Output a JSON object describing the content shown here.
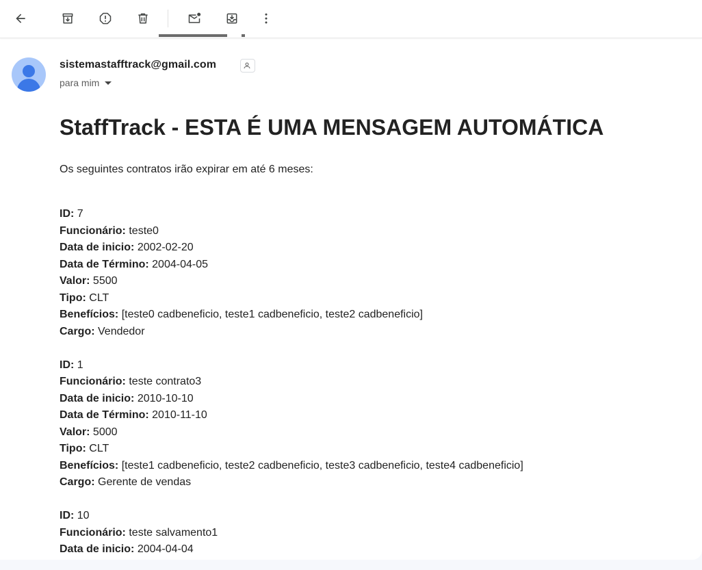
{
  "toolbar": {
    "back": "arrow-left-icon",
    "archive": "archive-icon",
    "spam": "report-spam-icon",
    "delete": "trash-icon",
    "unread": "mark-unread-icon",
    "move": "move-to-inbox-icon",
    "more": "more-vert-icon"
  },
  "email": {
    "sender": "sistemastafftrack@gmail.com",
    "recipient": "para mim",
    "title": "StaffTrack - ESTA É UMA MENSAGEM AUTOMÁTICA",
    "intro": "Os seguintes contratos irão expirar em até 6 meses:"
  },
  "contracts": [
    {
      "rows": [
        {
          "label": "ID:",
          "value": "7"
        },
        {
          "label": "Funcionário:",
          "value": "teste0"
        },
        {
          "label": "Data de inicio:",
          "value": "2002-02-20"
        },
        {
          "label": "Data de Término:",
          "value": "2004-04-05"
        },
        {
          "label": "Valor:",
          "value": "5500"
        },
        {
          "label": "Tipo:",
          "value": "CLT"
        },
        {
          "label": "Benefícios:",
          "value": "[teste0 cadbeneficio, teste1 cadbeneficio, teste2 cadbeneficio]"
        },
        {
          "label": "Cargo:",
          "value": "Vendedor"
        }
      ]
    },
    {
      "rows": [
        {
          "label": "ID:",
          "value": "1"
        },
        {
          "label": "Funcionário:",
          "value": "teste contrato3"
        },
        {
          "label": "Data de inicio:",
          "value": "2010-10-10"
        },
        {
          "label": "Data de Término:",
          "value": "2010-11-10"
        },
        {
          "label": "Valor:",
          "value": "5000"
        },
        {
          "label": "Tipo:",
          "value": "CLT"
        },
        {
          "label": "Benefícios:",
          "value": "[teste1 cadbeneficio, teste2 cadbeneficio, teste3 cadbeneficio, teste4 cadbeneficio]"
        },
        {
          "label": "Cargo:",
          "value": "Gerente de vendas"
        }
      ]
    },
    {
      "rows": [
        {
          "label": "ID:",
          "value": "10"
        },
        {
          "label": "Funcionário:",
          "value": "teste salvamento1"
        },
        {
          "label": "Data de inicio:",
          "value": "2004-04-04"
        }
      ]
    }
  ],
  "colors": {
    "avatar_bg": "#a8c7fa",
    "avatar_fg": "#3b78e7",
    "text": "#222222",
    "page_bg": "#f6f8fc"
  }
}
